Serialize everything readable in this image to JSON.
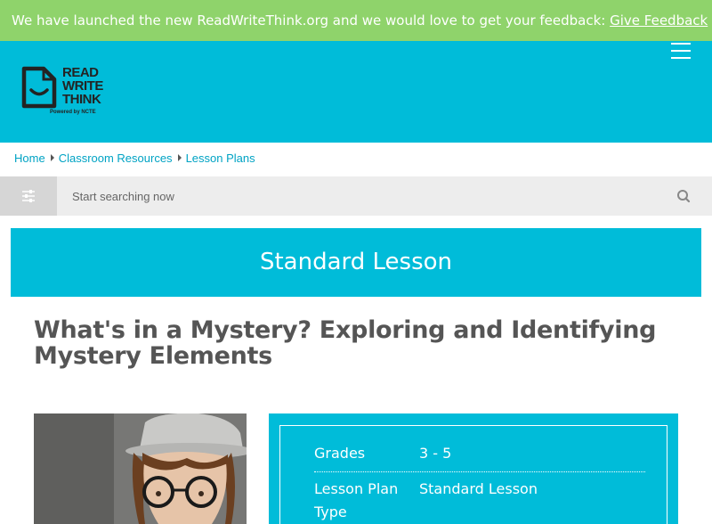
{
  "banner": {
    "text": "We have launched the new ReadWriteThink.org and we would love to get your feedback: ",
    "link": "Give Feedback"
  },
  "logo": {
    "line1": "READ",
    "line2": "WRITE",
    "line3": "THINK",
    "tagline": "Powered by NCTE"
  },
  "breadcrumb": [
    "Home",
    "Classroom Resources",
    "Lesson Plans"
  ],
  "search": {
    "placeholder": "Start searching now"
  },
  "lesson_type_banner": "Standard Lesson",
  "page_title": "What's in a Mystery? Exploring and Identifying Mystery Elements",
  "info": {
    "grades_label": "Grades",
    "grades_value": "3 - 5",
    "type_label": "Lesson Plan Type",
    "type_value": "Standard Lesson"
  },
  "colors": {
    "banner_green": "#8fd36b",
    "brand_cyan": "#00bcd9",
    "link_cyan": "#00a3c4",
    "title_gray": "#555555"
  },
  "icons": [
    "menu-icon",
    "filter-icon",
    "search-icon"
  ]
}
